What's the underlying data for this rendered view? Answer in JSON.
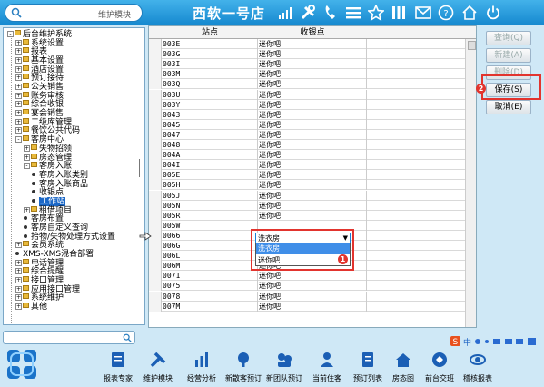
{
  "topbar": {
    "search_placeholder": "维护模块",
    "title": "西软一号店",
    "icons": [
      "signal-icon",
      "tools-icon",
      "phone-icon",
      "menu-icon",
      "star-icon",
      "columns-icon",
      "mail-icon",
      "help-icon",
      "home-icon",
      "power-icon"
    ]
  },
  "tree": [
    {
      "label": "后台维护系统",
      "level": 0,
      "kind": "folder",
      "pm": "-"
    },
    {
      "label": "系统设置",
      "level": 1,
      "kind": "folder",
      "pm": "+"
    },
    {
      "label": "报表",
      "level": 1,
      "kind": "folder",
      "pm": "+"
    },
    {
      "label": "基本设置",
      "level": 1,
      "kind": "folder",
      "pm": "+"
    },
    {
      "label": "酒店设置",
      "level": 1,
      "kind": "folder",
      "pm": "+"
    },
    {
      "label": "预订接待",
      "level": 1,
      "kind": "folder",
      "pm": "+"
    },
    {
      "label": "公关销售",
      "level": 1,
      "kind": "folder",
      "pm": "+"
    },
    {
      "label": "账务审核",
      "level": 1,
      "kind": "folder",
      "pm": "+"
    },
    {
      "label": "综合收银",
      "level": 1,
      "kind": "folder",
      "pm": "+"
    },
    {
      "label": "宴会销售",
      "level": 1,
      "kind": "folder",
      "pm": "+"
    },
    {
      "label": "二级库管理",
      "level": 1,
      "kind": "folder",
      "pm": "+"
    },
    {
      "label": "餐饮公共代码",
      "level": 1,
      "kind": "folder",
      "pm": "+"
    },
    {
      "label": "客房中心",
      "level": 1,
      "kind": "folder",
      "pm": "-"
    },
    {
      "label": "失物招领",
      "level": 2,
      "kind": "folder",
      "pm": "+"
    },
    {
      "label": "房态管理",
      "level": 2,
      "kind": "folder",
      "pm": "+"
    },
    {
      "label": "客房入账",
      "level": 2,
      "kind": "folder",
      "pm": "-"
    },
    {
      "label": "客房入账类别",
      "level": 3,
      "kind": "dot"
    },
    {
      "label": "客房入账商品",
      "level": 3,
      "kind": "dot"
    },
    {
      "label": "收银点",
      "level": 3,
      "kind": "dot"
    },
    {
      "label": "工作站",
      "level": 3,
      "kind": "dot",
      "selected": true
    },
    {
      "label": "租借项目",
      "level": 2,
      "kind": "folder",
      "pm": "+"
    },
    {
      "label": "客房布置",
      "level": 2,
      "kind": "dot"
    },
    {
      "label": "客房自定义查询",
      "level": 2,
      "kind": "dot"
    },
    {
      "label": "拾物/失物处理方式设置",
      "level": 2,
      "kind": "dot"
    },
    {
      "label": "会员系统",
      "level": 1,
      "kind": "folder",
      "pm": "+"
    },
    {
      "label": "XMS-XMS混合部署",
      "level": 1,
      "kind": "dot"
    },
    {
      "label": "电话管理",
      "level": 1,
      "kind": "folder",
      "pm": "+"
    },
    {
      "label": "综合提醒",
      "level": 1,
      "kind": "folder",
      "pm": "+"
    },
    {
      "label": "接口管理",
      "level": 1,
      "kind": "folder",
      "pm": "+"
    },
    {
      "label": "应用接口管理",
      "level": 1,
      "kind": "folder",
      "pm": "+"
    },
    {
      "label": "系统维护",
      "level": 1,
      "kind": "folder",
      "pm": "+"
    },
    {
      "label": "其他",
      "level": 1,
      "kind": "folder",
      "pm": "+"
    }
  ],
  "grid": {
    "headers": [
      "站点",
      "收银点"
    ],
    "rows": [
      [
        "003E",
        "迷你吧"
      ],
      [
        "003G",
        "迷你吧"
      ],
      [
        "003I",
        "迷你吧"
      ],
      [
        "003M",
        "迷你吧"
      ],
      [
        "003Q",
        "迷你吧"
      ],
      [
        "003U",
        "迷你吧"
      ],
      [
        "003Y",
        "迷你吧"
      ],
      [
        "0043",
        "迷你吧"
      ],
      [
        "0045",
        "迷你吧"
      ],
      [
        "0047",
        "迷你吧"
      ],
      [
        "0048",
        "迷你吧"
      ],
      [
        "004A",
        "迷你吧"
      ],
      [
        "004I",
        "迷你吧"
      ],
      [
        "005E",
        "迷你吧"
      ],
      [
        "005H",
        "迷你吧"
      ],
      [
        "005J",
        "迷你吧"
      ],
      [
        "005N",
        "迷你吧"
      ],
      [
        "005R",
        "迷你吧"
      ],
      [
        "005W",
        "洗衣房"
      ],
      [
        "0066",
        ""
      ],
      [
        "006G",
        ""
      ],
      [
        "006L",
        "迷你吧"
      ],
      [
        "006M",
        "迷你吧"
      ],
      [
        "0071",
        "迷你吧"
      ],
      [
        "0075",
        "迷你吧"
      ],
      [
        "0078",
        "迷你吧"
      ],
      [
        "007M",
        "迷你吧"
      ]
    ],
    "editing_row": 18
  },
  "dropdown": {
    "current": "洗衣房",
    "options": [
      "洗衣房",
      "迷你吧"
    ],
    "highlighted": 0
  },
  "badges": {
    "b1": "1",
    "b2": "2"
  },
  "buttons": {
    "query": "查询(Q)",
    "new": "新建(A)",
    "delete": "删除(D)",
    "save": "保存(S)",
    "cancel": "取消(E)"
  },
  "dock": [
    {
      "label": "报表专家",
      "icon": "report-icon"
    },
    {
      "label": "维护模块",
      "icon": "wrench-icon"
    },
    {
      "label": "经营分析",
      "icon": "bar-chart-icon"
    },
    {
      "label": "新散客预订",
      "icon": "booking-icon"
    },
    {
      "label": "新团队预订",
      "icon": "group-booking-icon"
    },
    {
      "label": "当前住客",
      "icon": "guest-icon"
    },
    {
      "label": "预订列表",
      "icon": "list-icon"
    },
    {
      "label": "房态图",
      "icon": "house-icon"
    },
    {
      "label": "前台交班",
      "icon": "handover-icon"
    },
    {
      "label": "稽核报表",
      "icon": "audit-icon"
    }
  ],
  "colors": {
    "topbar": "#1f97dd",
    "highlight": "#e2342e",
    "selection": "#1c68c7"
  }
}
